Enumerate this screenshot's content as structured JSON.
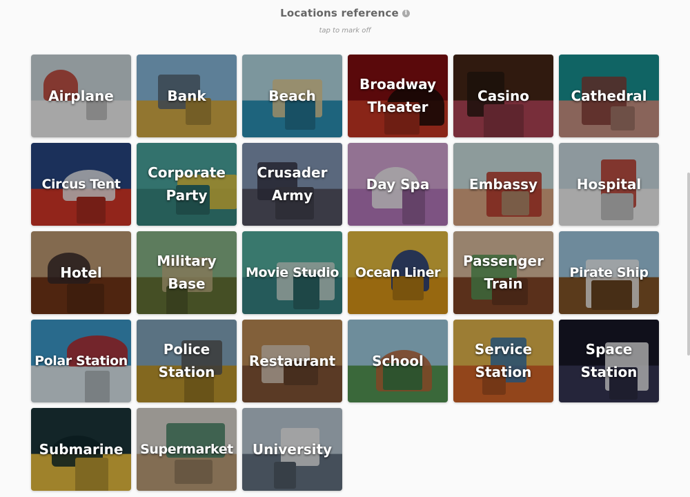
{
  "header": {
    "title": "Locations reference",
    "info_glyph": "i",
    "subtitle": "tap to mark off"
  },
  "cards": [
    {
      "label": "Airplane",
      "icon": "airplane-illustration",
      "colors": [
        "#dbe6ec",
        "#ffffff",
        "#c63d2f"
      ]
    },
    {
      "label": "Bank",
      "icon": "bank-illustration",
      "colors": [
        "#8fc3e8",
        "#e0b54a",
        "#5a6b7a"
      ]
    },
    {
      "label": "Beach",
      "icon": "beach-illustration",
      "colors": [
        "#bfe6f2",
        "#2e9ac1",
        "#f0d79e"
      ]
    },
    {
      "label": "Broadway\nTheater",
      "icon": "theater-illustration",
      "colors": [
        "#8a0f12",
        "#d33a26",
        "#1a0c08"
      ]
    },
    {
      "label": "Casino",
      "icon": "casino-illustration",
      "colors": [
        "#4a2818",
        "#b8485a",
        "#2a1a12"
      ]
    },
    {
      "label": "Cathedral",
      "icon": "cathedral-illustration",
      "colors": [
        "#1a9a9a",
        "#d39a8a",
        "#8a3f3a"
      ]
    },
    {
      "label": "Circus Tent",
      "icon": "circus-tent-illustration",
      "colors": [
        "#2a4a8a",
        "#e03a2a",
        "#ffffff"
      ]
    },
    {
      "label": "Corporate\nParty",
      "icon": "party-illustration",
      "colors": [
        "#4fb0a8",
        "#3b8f88",
        "#f4d03f"
      ]
    },
    {
      "label": "Crusader\nArmy",
      "icon": "army-illustration",
      "colors": [
        "#8aa0c0",
        "#5a5a6a",
        "#3a3a4a"
      ]
    },
    {
      "label": "Day Spa",
      "icon": "spa-illustration",
      "colors": [
        "#e0b0e0",
        "#c080c8",
        "#ffffff"
      ]
    },
    {
      "label": "Embassy",
      "icon": "embassy-illustration",
      "colors": [
        "#d9efef",
        "#e8b18a",
        "#c23a2a"
      ]
    },
    {
      "label": "Hospital",
      "icon": "hospital-illustration",
      "colors": [
        "#d9eaf2",
        "#ffffff",
        "#c23a2a"
      ]
    },
    {
      "label": "Hotel",
      "icon": "hotel-illustration",
      "colors": [
        "#c9a37a",
        "#7a3a1a",
        "#3a2a2a"
      ]
    },
    {
      "label": "Military\nBase",
      "icon": "military-illustration",
      "colors": [
        "#8fbf8f",
        "#6b7a3a",
        "#c9b98a"
      ]
    },
    {
      "label": "Movie Studio",
      "icon": "studio-illustration",
      "colors": [
        "#58b8a8",
        "#3a8a8a",
        "#d8e8e0"
      ]
    },
    {
      "label": "Ocean Liner",
      "icon": "ship-illustration",
      "colors": [
        "#f5c842",
        "#e8a01a",
        "#1a3a8a"
      ]
    },
    {
      "label": "Passenger\nTrain",
      "icon": "train-illustration",
      "colors": [
        "#e8c8a8",
        "#8a4a2a",
        "#5aa05a"
      ]
    },
    {
      "label": "Pirate Ship",
      "icon": "pirate-ship-illustration",
      "colors": [
        "#a9d4ee",
        "#8a5a2a",
        "#ffffff"
      ]
    },
    {
      "label": "Polar Station",
      "icon": "polar-station-illustration",
      "colors": [
        "#3fa4d8",
        "#e8f4fa",
        "#c62828"
      ]
    },
    {
      "label": "Police\nStation",
      "icon": "police-illustration",
      "colors": [
        "#8ab0c8",
        "#c9a030",
        "#5a5a5a"
      ]
    },
    {
      "label": "Restaurant",
      "icon": "restaurant-illustration",
      "colors": [
        "#c8945a",
        "#8a5a3a",
        "#e8d8c8"
      ]
    },
    {
      "label": "School",
      "icon": "school-illustration",
      "colors": [
        "#a9d9ee",
        "#5aa05a",
        "#c66a3a"
      ]
    },
    {
      "label": "Service\nStation",
      "icon": "gas-station-illustration",
      "colors": [
        "#f0c050",
        "#e06a2a",
        "#3a7ab0"
      ]
    },
    {
      "label": "Space\nStation",
      "icon": "space-illustration",
      "colors": [
        "#1a1a2a",
        "#3a3a5a",
        "#ffffff"
      ]
    },
    {
      "label": "Submarine",
      "icon": "submarine-illustration",
      "colors": [
        "#1e3a3e",
        "#f5c842",
        "#0f2a2e"
      ]
    },
    {
      "label": "Supermarket",
      "icon": "supermarket-illustration",
      "colors": [
        "#e8e4dc",
        "#c8a880",
        "#4a8a6a"
      ]
    },
    {
      "label": "University",
      "icon": "university-illustration",
      "colors": [
        "#c8d8e4",
        "#6a7a8a",
        "#ffffff"
      ]
    }
  ]
}
